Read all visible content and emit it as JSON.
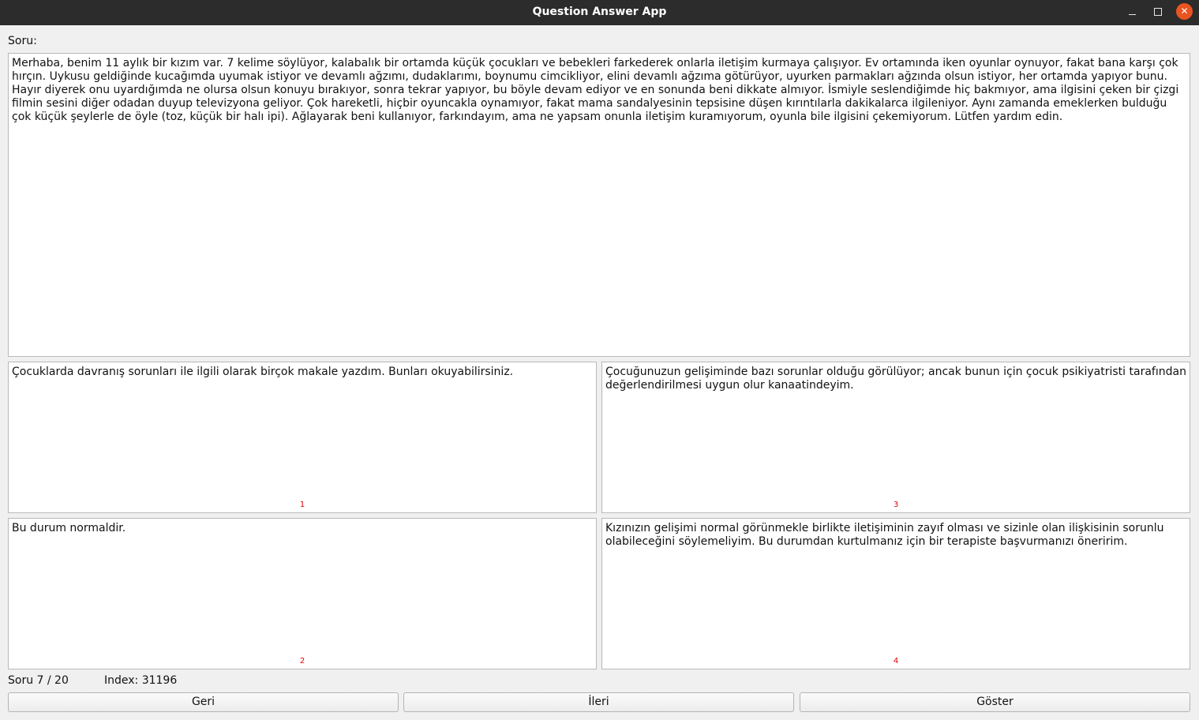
{
  "window": {
    "title": "Question Answer App",
    "minimize_glyph": "",
    "close_glyph": "✕"
  },
  "question": {
    "label": "Soru:",
    "text": "Merhaba, benim 11 aylık bir kızım var. 7 kelime söylüyor, kalabalık bir ortamda küçük çocukları ve bebekleri farkederek onlarla iletişim kurmaya çalışıyor. Ev ortamında iken oyunlar oynuyor, fakat bana karşı çok hırçın. Uykusu geldiğinde kucağımda uyumak istiyor ve devamlı ağzımı, dudaklarımı, boynumu cimcikliyor, elini devamlı ağzıma götürüyor, uyurken parmakları ağzında olsun istiyor, her ortamda yapıyor bunu. Hayır diyerek onu uyardığımda ne olursa olsun konuyu bırakıyor, sonra tekrar yapıyor, bu böyle devam ediyor ve en sonunda beni dikkate almıyor. İsmiyle seslendiğimde hiç bakmıyor, ama ilgisini çeken bir çizgi filmin sesini diğer odadan duyup televizyona geliyor. Çok hareketli, hiçbir oyuncakla oynamıyor, fakat mama sandalyesinin tepsisine düşen kırıntılarla dakikalarca ilgileniyor. Aynı zamanda emeklerken bulduğu çok küçük şeylerle de öyle (toz, küçük bir halı ipi). Ağlayarak beni kullanıyor, farkındayım, ama ne yapsam onunla iletişim kuramıyorum, oyunla bile ilgisini çekemiyorum. Lütfen yardım edin."
  },
  "answers": [
    {
      "number": "1",
      "text": "Çocuklarda davranış sorunları ile ilgili olarak birçok makale yazdım. Bunları okuyabilirsiniz."
    },
    {
      "number": "2",
      "text": "Bu durum normaldir."
    },
    {
      "number": "3",
      "text": "Çocuğunuzun gelişiminde bazı sorunlar olduğu görülüyor; ancak bunun için çocuk psikiyatristi tarafından değerlendirilmesi uygun olur kanaatindeyim."
    },
    {
      "number": "4",
      "text": "Kızınızın gelişimi normal görünmekle birlikte iletişiminin zayıf olması ve sizinle olan ilişkisinin sorunlu olabileceğini söylemeliyim. Bu durumdan kurtulmanız için bir terapiste başvurmanızı öneririm."
    }
  ],
  "status": {
    "progress": "Soru 7 / 20",
    "index": "Index: 31196"
  },
  "buttons": {
    "back": "Geri",
    "next": "İleri",
    "show": "Göster"
  },
  "colors": {
    "titlebar": "#2c2c2c",
    "close_button": "#e95420",
    "answer_number": "#e00000"
  },
  "icons": {
    "minimize": "minimize-icon",
    "maximize": "maximize-icon",
    "close": "close-icon"
  }
}
